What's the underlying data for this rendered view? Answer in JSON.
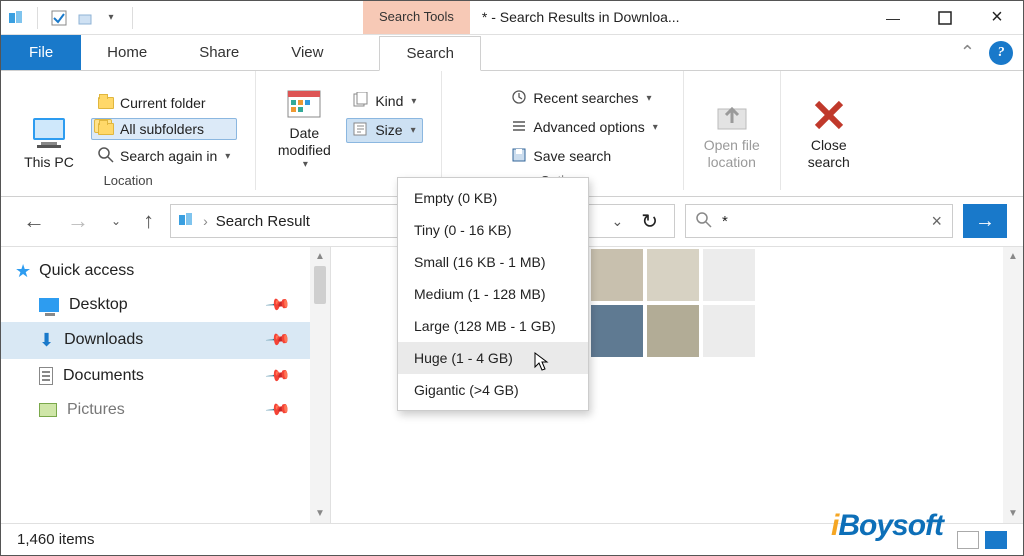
{
  "title_context": "Search Tools",
  "window_title": "* - Search Results in Downloa...",
  "tabs": {
    "file": "File",
    "home": "Home",
    "share": "Share",
    "view": "View",
    "search": "Search"
  },
  "ribbon": {
    "this_pc": "This PC",
    "location": {
      "current_folder": "Current folder",
      "all_subfolders": "All subfolders",
      "search_again_in": "Search again in",
      "group_label": "Location"
    },
    "date_modified": "Date modified",
    "refine": {
      "kind": "Kind",
      "size": "Size"
    },
    "options": {
      "recent_searches": "Recent searches",
      "advanced_options": "Advanced options",
      "save_search": "Save search",
      "group_label": "Options"
    },
    "open_file_location": "Open file location",
    "close_search": "Close search"
  },
  "size_menu": [
    "Empty (0 KB)",
    "Tiny (0 - 16 KB)",
    "Small (16 KB - 1 MB)",
    "Medium (1 - 128 MB)",
    "Large (128 MB - 1 GB)",
    "Huge (1 - 4 GB)",
    "Gigantic (>4 GB)"
  ],
  "size_menu_hover_index": 5,
  "address_text": "Search Result",
  "search_query": "*",
  "sidebar": {
    "quick_access": "Quick access",
    "items": [
      "Desktop",
      "Downloads",
      "Documents",
      "Pictures"
    ],
    "selected_index": 1
  },
  "status_text": "1,460 items",
  "watermark": "iBoysoft"
}
